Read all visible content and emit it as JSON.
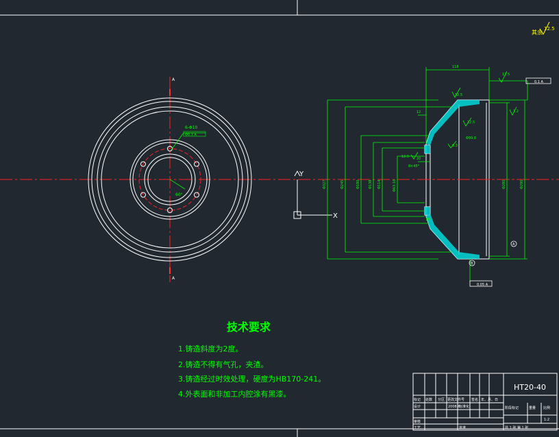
{
  "colors": {
    "background": "#212830",
    "lines": "#ffffff",
    "centerline": "#ff2020",
    "dimension": "#00ff00",
    "text_green": "#00ff00",
    "hatch": "#00d8d8",
    "text_yellow": "#ffff00",
    "marker": "#ff3030"
  },
  "front_view": {
    "section_letter_top": "A",
    "section_letter_bottom": "A",
    "hole_callout": "6-Φ10",
    "tolerance_frame": "Φ0.3 A",
    "angle_label": "60°"
  },
  "section_view": {
    "dim_top": "118",
    "dim_left_small": "12",
    "dim_mid_small": "20",
    "roughness_top": "12.5",
    "roughness_marks": [
      "12.5",
      "12.5",
      "3.2",
      "12.5",
      "6.3",
      "12.5"
    ],
    "runout_top": "0.1 A",
    "runout_bottom": "0.05 A",
    "callout_a": "A",
    "callout_b": "B",
    "dia_outer_left": "Φ327",
    "dia_2": "Φ245",
    "dia_3": "Φ180",
    "dia_4": "Φ138",
    "dia_5": "Φ114",
    "dia_6": "Φ63.16",
    "dia_right_1": "Φ280",
    "dia_right_2": "Φ290",
    "note_mid": "Φ99.8",
    "note_left": "8×45°",
    "radius": "R5"
  },
  "roughness_corner": "12.5",
  "roughness_other": "其余",
  "axis": {
    "y": "Y",
    "x": "X"
  },
  "requirements": {
    "title": "技术要求",
    "items": [
      "1.铸造斜度为2度。",
      "2.铸造不得有气孔，夹渣。",
      "3.铸造经过时效处理，硬度为HB170-241。",
      "4.外表面和非加工内腔涂有黑漆。"
    ]
  },
  "title_block": {
    "material": "HT20-40",
    "row1": [
      "标记",
      "处数",
      "分区",
      "更改文件号",
      "签名",
      "年、月、日"
    ],
    "row2": [
      "设计",
      "",
      "标准化",
      "",
      "",
      ""
    ],
    "date": "2008.6",
    "stage_labels": [
      "阶段标记",
      "重量",
      "比例"
    ],
    "scale": "1:2",
    "row_review": "审核",
    "row_process": "工艺",
    "row_approve": "批准",
    "sheets": "共 1 张 第 1 张"
  }
}
